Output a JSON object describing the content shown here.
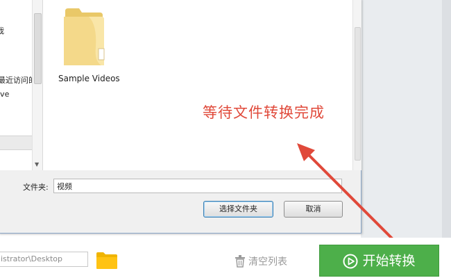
{
  "dialog": {
    "nav_items": [
      "栽",
      "最近访问的位置",
      "ive"
    ],
    "folder_item": {
      "label": "Sample Videos",
      "icon": "folder-icon"
    },
    "folder_field_label": "文件夹:",
    "folder_field_value": "视频",
    "select_button": "选择文件夹",
    "cancel_button": "取消"
  },
  "annotation": {
    "text": "等待文件转换完成",
    "color": "#e0493a"
  },
  "toolbar": {
    "output_path": "istrator\\Desktop",
    "open_folder_icon": "folder-icon",
    "clear_list_label": "清空列表",
    "clear_list_icon": "trash-icon",
    "start_button": "开始转换",
    "start_icon": "play-circle-icon",
    "accent": "#4daf4a"
  }
}
